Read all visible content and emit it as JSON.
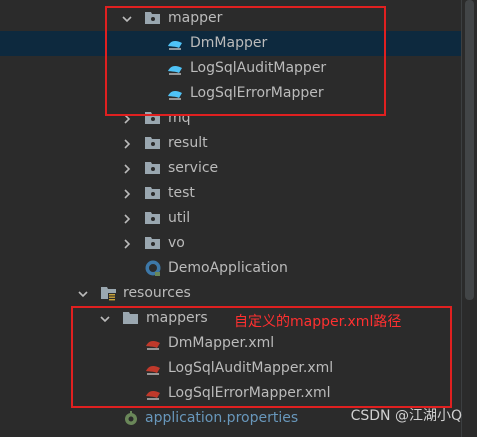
{
  "tree": {
    "rows": [
      {
        "label": "mapper",
        "kind": "folder",
        "expanded": true
      },
      {
        "label": "DmMapper",
        "kind": "mapper-class",
        "selected": true
      },
      {
        "label": "LogSqlAuditMapper",
        "kind": "mapper-class"
      },
      {
        "label": "LogSqlErrorMapper",
        "kind": "mapper-class"
      },
      {
        "label": "mq",
        "kind": "folder",
        "expanded": false
      },
      {
        "label": "result",
        "kind": "folder",
        "expanded": false
      },
      {
        "label": "service",
        "kind": "folder",
        "expanded": false
      },
      {
        "label": "test",
        "kind": "folder",
        "expanded": false
      },
      {
        "label": "util",
        "kind": "folder",
        "expanded": false
      },
      {
        "label": "vo",
        "kind": "folder",
        "expanded": false
      },
      {
        "label": "DemoApplication",
        "kind": "spring-class"
      },
      {
        "label": "resources",
        "kind": "resources-folder",
        "expanded": true
      },
      {
        "label": "mappers",
        "kind": "folder",
        "expanded": true
      },
      {
        "label": "DmMapper.xml",
        "kind": "mybatis-xml"
      },
      {
        "label": "LogSqlAuditMapper.xml",
        "kind": "mybatis-xml"
      },
      {
        "label": "LogSqlErrorMapper.xml",
        "kind": "mybatis-xml"
      },
      {
        "label": "application.properties",
        "kind": "properties"
      }
    ]
  },
  "annotation": {
    "text": "自定义的mapper.xml路径",
    "color": "#e02020"
  },
  "watermark": "CSDN @江湖小Q",
  "colors": {
    "background": "#2b2b2b",
    "selected_row": "#0d293e",
    "text": "#bbbbbb",
    "folder": "#9aa7b0",
    "mapper_icon": "#4fc3f7",
    "xml_icon": "#c0392b",
    "properties_text": "#6897bb"
  }
}
